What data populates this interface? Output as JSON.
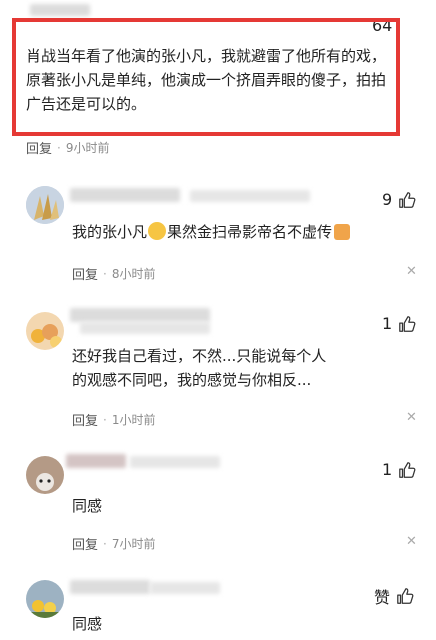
{
  "comments": [
    {
      "likes": "64",
      "text": "肖战当年看了他演的张小凡，我就避雷了他所有的戏，原著张小凡是单纯，他演成一个挤眉弄眼的傻子，拍拍广告还是可以的。",
      "reply_label": "回复",
      "time": "9小时前"
    },
    {
      "likes": "9",
      "text_a": "我的张小凡",
      "text_b": "果然金扫帚影帝名不虚传",
      "reply_label": "回复",
      "time": "8小时前"
    },
    {
      "likes": "1",
      "text": "还好我自己看过，不然...只能说每个人的观感不同吧，我的感觉与你相反...",
      "reply_label": "回复",
      "time": "1小时前"
    },
    {
      "likes": "1",
      "text": "同感",
      "reply_label": "回复",
      "time": "7小时前"
    },
    {
      "likes": "赞",
      "text": "同感"
    }
  ],
  "colors": {
    "highlight": "#e53935",
    "meta": "#8a8a8a"
  },
  "icons": {
    "like": "thumbs-up-icon",
    "close": "close-icon"
  }
}
